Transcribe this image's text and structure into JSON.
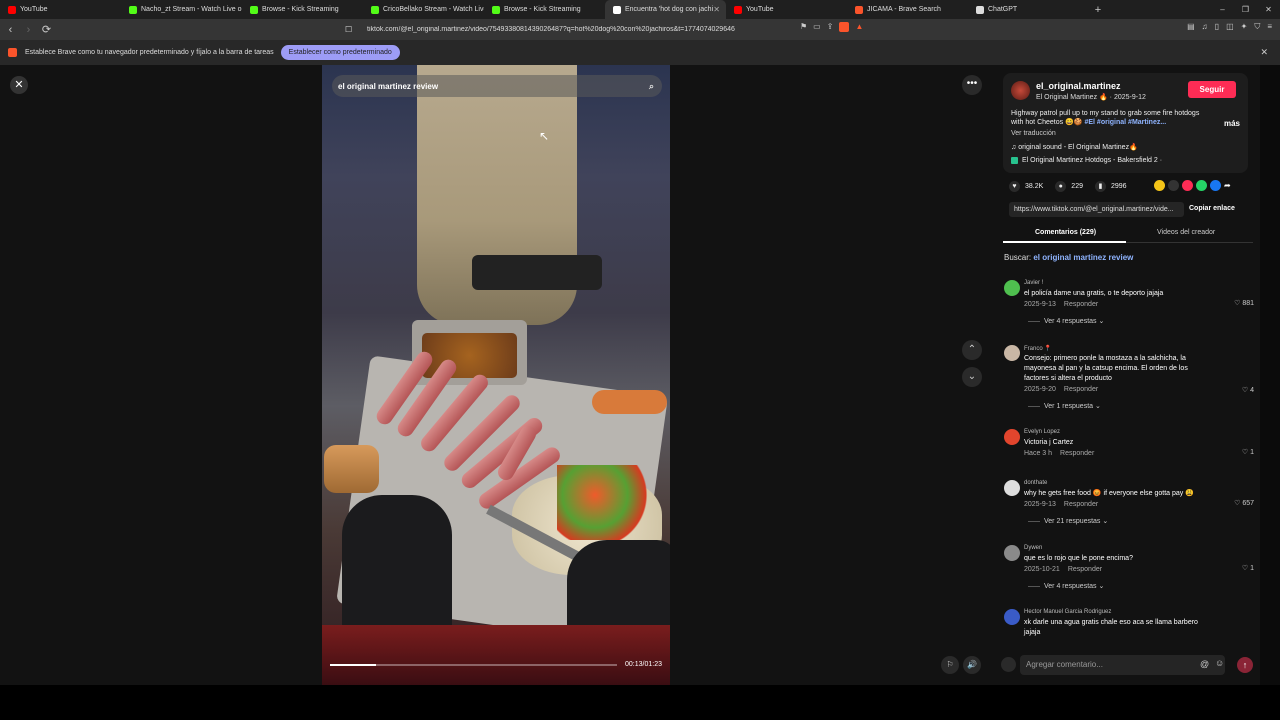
{
  "tabs": [
    {
      "label": "YouTube",
      "color": "#ff0000",
      "active": false
    },
    {
      "label": "Nacho_zt Stream - Watch Live on Ki",
      "color": "#53fc18",
      "active": false
    },
    {
      "label": "Browse - Kick Streaming",
      "color": "#53fc18",
      "active": false
    },
    {
      "label": "CricoBellako Stream - Watch Live on",
      "color": "#53fc18",
      "active": false
    },
    {
      "label": "Browse - Kick Streaming",
      "color": "#53fc18",
      "active": false
    },
    {
      "label": "Encuentra 'hot dog con jachi",
      "color": "#ffffff",
      "active": true
    },
    {
      "label": "YouTube",
      "color": "#ff0000",
      "active": false
    },
    {
      "label": "JICAMA - Brave Search",
      "color": "#fb542b",
      "active": false
    },
    {
      "label": "ChatGPT",
      "color": "#dddddd",
      "active": false
    }
  ],
  "address": {
    "url": "tiktok.com/@el_original.martinez/video/7549338081439026487?q=hot%20dog%20con%20jachiros&t=1774074029646"
  },
  "infobar": {
    "message": "Establece Brave como tu navegador predeterminado y fíjalo a la barra de tareas",
    "button": "Establecer como predeterminado"
  },
  "video": {
    "search_text": "el original martinez review",
    "time": "00:13/01:23",
    "progress_fraction": 0.16
  },
  "author": {
    "username": "el_original.martinez",
    "display": "El Original Martinez 🔥 · 2025-9-12",
    "follow_label": "Seguir",
    "description": "Highway patrol pull up to my stand to grab some fire hotdogs with hot Cheetos 😄🍪",
    "tags": "#El #original #Martinez...",
    "more_label": "más",
    "translate_label": "Ver traducción",
    "sound": "♫  original sound - El Original Martinez🔥",
    "place": "El Original Martinez Hotdogs - Bakersfield  2 ·"
  },
  "stats": {
    "likes": "38.2K",
    "comments": "229",
    "saves": "2996"
  },
  "link": {
    "url": "https://www.tiktok.com/@el_original.martinez/vide...",
    "copy_label": "Copiar enlace"
  },
  "panel_tabs": {
    "comments": "Comentarios (229)",
    "creator_videos": "Videos del creador"
  },
  "search_hint": {
    "label": "Buscar: ",
    "query": "el original martinez review"
  },
  "comments": [
    {
      "name": "Javier !",
      "text": "el policía dame una gratis, o te deporto jajaja",
      "date": "2025-9-13",
      "reply": "Responder",
      "likes": "881",
      "replies": "Ver 4 respuestas ⌄",
      "avatar_color": "#4fbf4f"
    },
    {
      "name": "Franco 📍",
      "text": "Consejo: primero ponle la mostaza a la salchicha, la mayonesa al pan y la catsup encima. El orden de los factores si altera el producto",
      "date": "2025-9-20",
      "reply": "Responder",
      "likes": "4",
      "replies": "Ver 1 respuesta ⌄",
      "avatar_color": "#c9b7a5"
    },
    {
      "name": "Evelyn Lopez",
      "text": "Victoria j Cartez",
      "date": "Hace 3 h",
      "reply": "Responder",
      "likes": "1",
      "replies": "",
      "avatar_color": "#e2452d"
    },
    {
      "name": "donthate",
      "text": "why he gets free food 😡 if everyone else gotta pay 😩",
      "date": "2025-9-13",
      "reply": "Responder",
      "likes": "657",
      "replies": "Ver 21 respuestas ⌄",
      "avatar_color": "#dddddd"
    },
    {
      "name": "Dywen",
      "text": "que es lo rojo que le pone encima?",
      "date": "2025-10-21",
      "reply": "Responder",
      "likes": "1",
      "replies": "Ver 4 respuestas ⌄",
      "avatar_color": "#8a8a8a"
    },
    {
      "name": "Hector Manuel Garcia Rodriguez",
      "text": "xk darle una agua gratis chale eso aca se llama barbero jajaja",
      "date": "",
      "reply": "",
      "likes": "",
      "replies": "",
      "avatar_color": "#3a5bc7"
    }
  ],
  "add_comment": {
    "placeholder": "Agregar comentario..."
  }
}
